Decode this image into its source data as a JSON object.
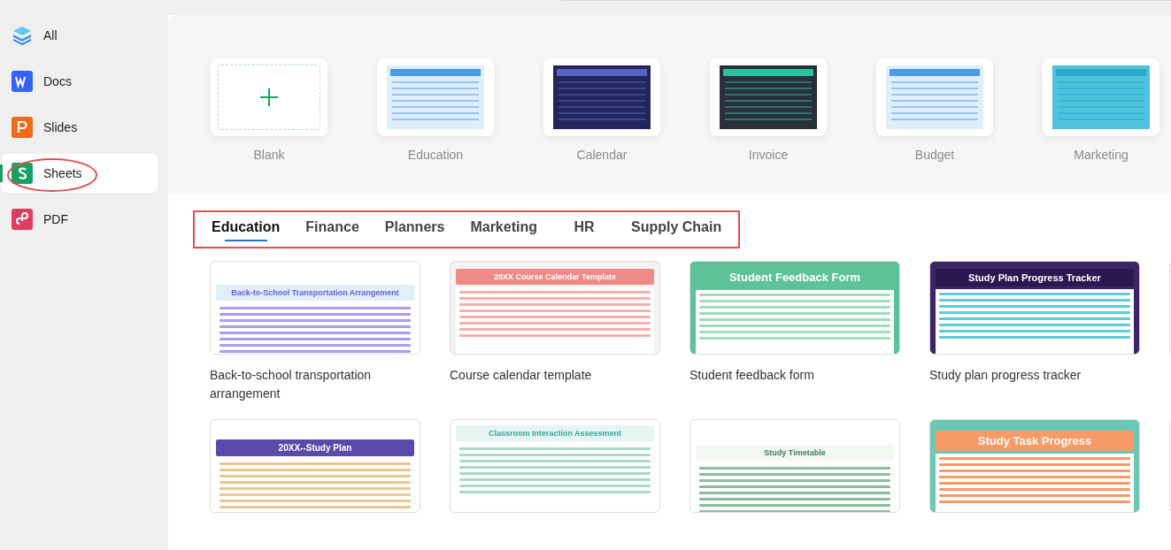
{
  "sidebar": {
    "items": [
      {
        "label": "All",
        "kind": "all",
        "selected": false
      },
      {
        "label": "Docs",
        "kind": "docs",
        "selected": false
      },
      {
        "label": "Slides",
        "kind": "slides",
        "selected": false
      },
      {
        "label": "Sheets",
        "kind": "sheets",
        "selected": true
      },
      {
        "label": "PDF",
        "kind": "pdf",
        "selected": false
      }
    ]
  },
  "quick_templates": [
    {
      "label": "Blank",
      "kind": "blank"
    },
    {
      "label": "Education",
      "kind": "light"
    },
    {
      "label": "Calendar",
      "kind": "navy"
    },
    {
      "label": "Invoice",
      "kind": "dark"
    },
    {
      "label": "Budget",
      "kind": "light"
    },
    {
      "label": "Marketing",
      "kind": "teal"
    }
  ],
  "category_tabs": [
    {
      "label": "Education",
      "selected": true
    },
    {
      "label": "Finance",
      "selected": false
    },
    {
      "label": "Planners",
      "selected": false
    },
    {
      "label": "Marketing",
      "selected": false
    },
    {
      "label": "HR",
      "selected": false
    },
    {
      "label": "Supply Chain",
      "selected": false
    }
  ],
  "templates": [
    {
      "title": "Back-to-school transportation arrangement",
      "preview_title": "Back-to-School Transportation Arrangement",
      "kind": "sky"
    },
    {
      "title": "Course calendar template",
      "preview_title": "20XX Course Calendar Template",
      "kind": "pink"
    },
    {
      "title": "Student feedback form",
      "preview_title": "Student Feedback Form",
      "kind": "green"
    },
    {
      "title": "Study plan progress tracker",
      "preview_title": "Study Plan Progress Tracker",
      "kind": "purple"
    },
    {
      "preview_title": "20XX--Study Plan",
      "kind": "violet"
    },
    {
      "preview_title": "Classroom Interaction Assessment",
      "kind": "mint"
    },
    {
      "preview_title": "Study Timetable",
      "kind": "sage"
    },
    {
      "preview_title": "Study Task Progress",
      "kind": "orange"
    }
  ]
}
